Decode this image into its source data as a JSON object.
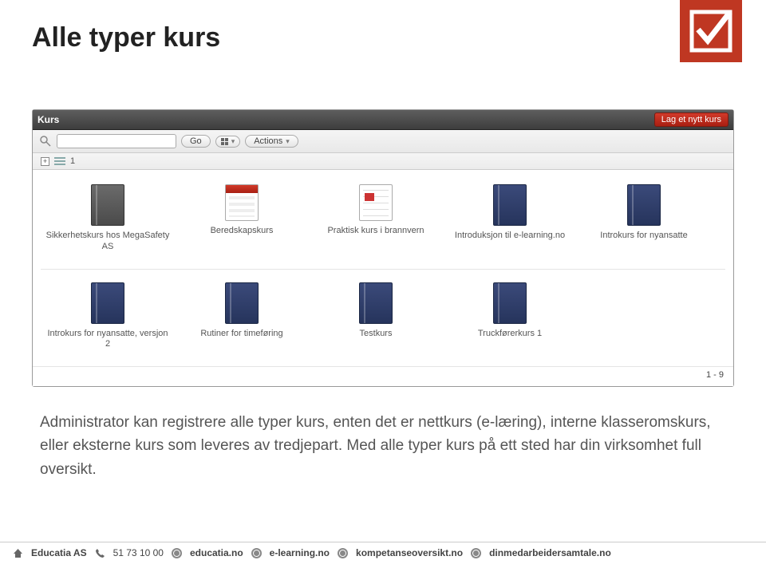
{
  "page_title": "Alle typer kurs",
  "app": {
    "header_title": "Kurs",
    "new_button": "Lag et nytt kurs",
    "toolbar": {
      "search_placeholder": "",
      "go_label": "Go",
      "actions_label": "Actions",
      "page_indicator": "1"
    },
    "courses": [
      {
        "label": "Sikkerhetskurs hos MegaSafety AS",
        "icon": "book-grey"
      },
      {
        "label": "Beredskapskurs",
        "icon": "calendar"
      },
      {
        "label": "Praktisk kurs i brannvern",
        "icon": "calendar-small"
      },
      {
        "label": "Introduksjon til e-learning.no",
        "icon": "book-blue"
      },
      {
        "label": "Introkurs for nyansatte",
        "icon": "book-blue"
      },
      {
        "label": "Introkurs for nyansatte, versjon 2",
        "icon": "book-blue"
      },
      {
        "label": "Rutiner for timeføring",
        "icon": "book-blue"
      },
      {
        "label": "Testkurs",
        "icon": "book-blue"
      },
      {
        "label": "Truckførerkurs 1",
        "icon": "book-blue"
      }
    ],
    "footer_count": "1 - 9"
  },
  "description": "Administrator kan registrere alle typer kurs, enten det er nettkurs (e-læring), interne klasseromskurs, eller eksterne kurs som leveres av tredjepart. Med alle typer kurs på ett sted har din virksomhet full oversikt.",
  "footer": {
    "company": "Educatia AS",
    "phone": "51 73 10 00",
    "links": [
      "educatia.no",
      "e-learning.no",
      "kompetanseoversikt.no",
      "dinmedarbeidersamtale.no"
    ]
  }
}
